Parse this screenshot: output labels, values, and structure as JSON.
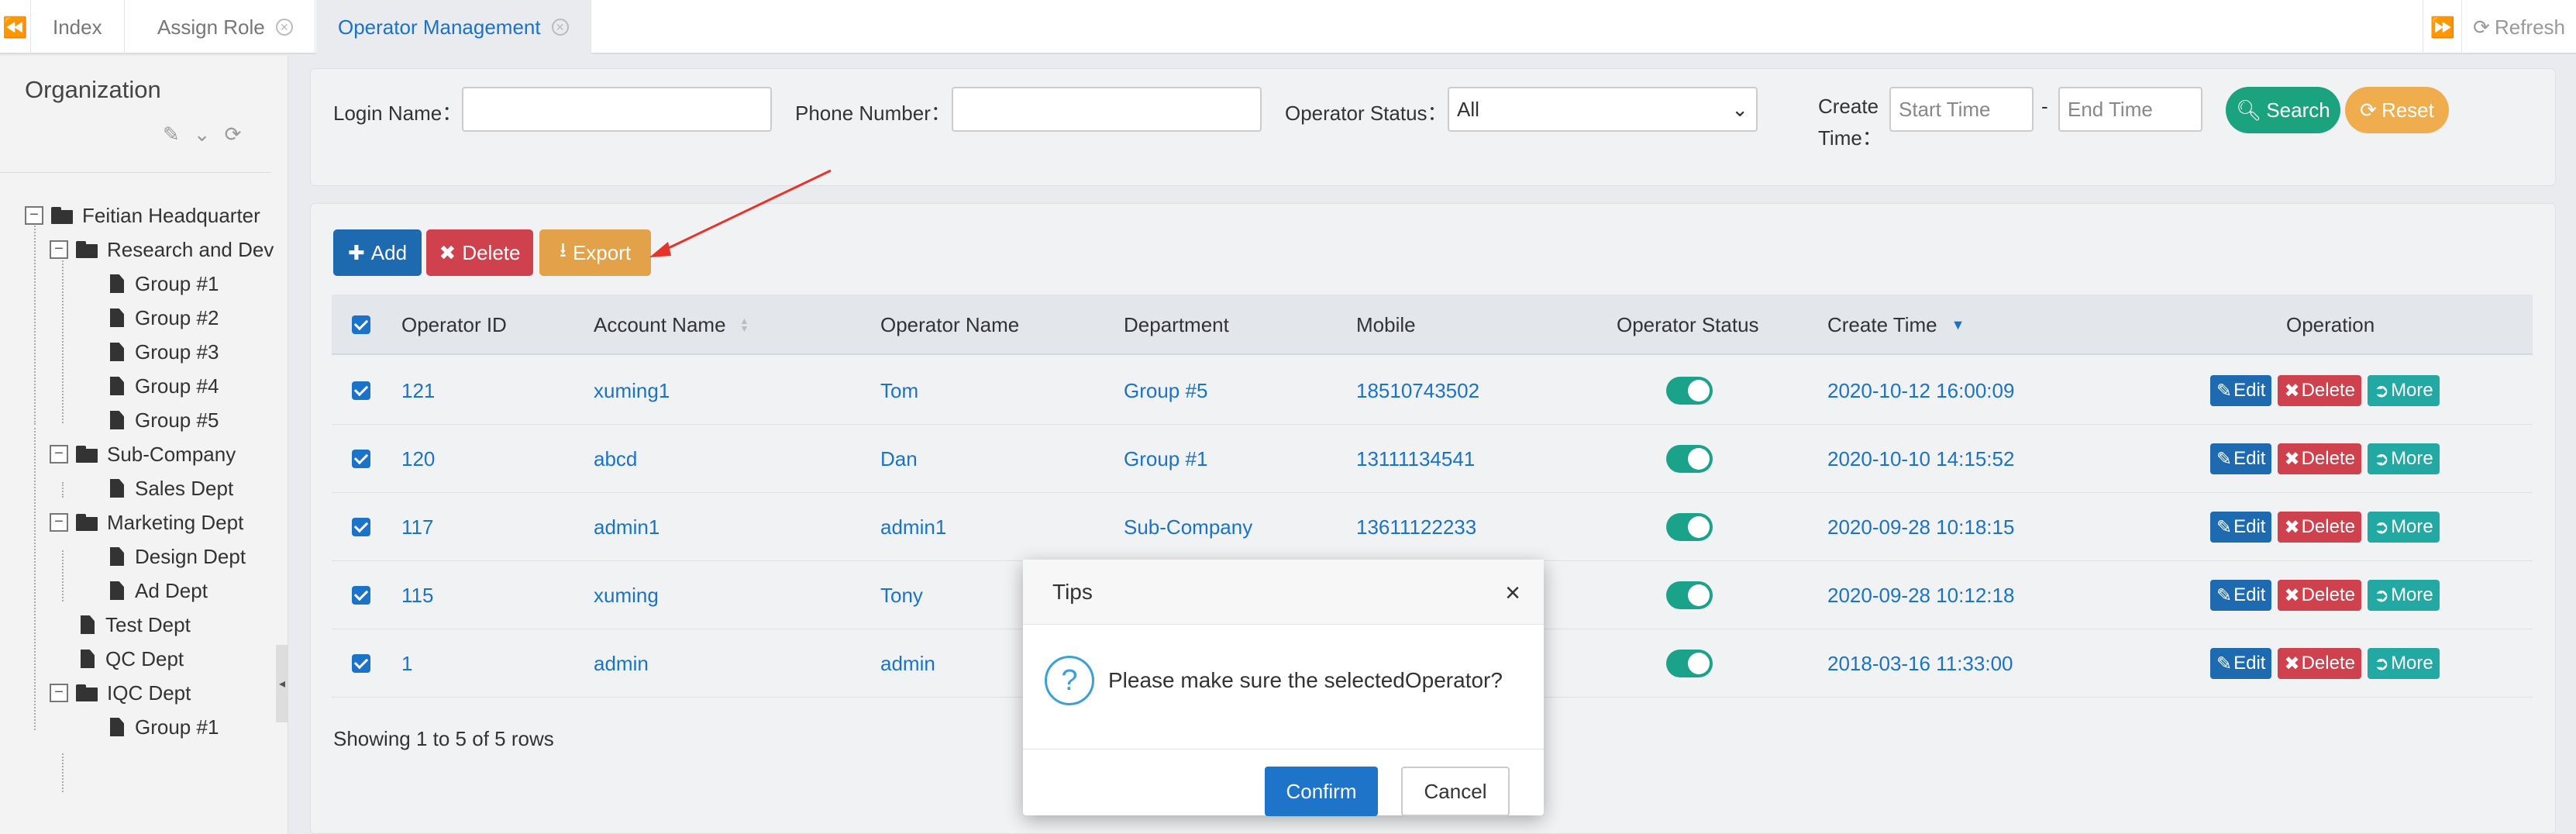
{
  "tabs": [
    {
      "label": "Index"
    },
    {
      "label": "Assign Role"
    },
    {
      "label": "Operator Management"
    }
  ],
  "topright": {
    "refresh_label": "Refresh"
  },
  "sidebar": {
    "title": "Organization",
    "tree": [
      {
        "label": "Feitian Headquarter"
      },
      {
        "label": "Research and Dev"
      },
      {
        "label": "Group #1"
      },
      {
        "label": "Group #2"
      },
      {
        "label": "Group #3"
      },
      {
        "label": "Group #4"
      },
      {
        "label": "Group #5"
      },
      {
        "label": "Sub-Company"
      },
      {
        "label": "Sales Dept"
      },
      {
        "label": "Marketing Dept"
      },
      {
        "label": "Design Dept"
      },
      {
        "label": "Ad Dept"
      },
      {
        "label": "Test Dept"
      },
      {
        "label": "QC Dept"
      },
      {
        "label": "IQC Dept"
      },
      {
        "label": "Group #1"
      }
    ]
  },
  "search": {
    "login_name_label": "Login Name：",
    "login_name_value": "",
    "phone_label": "Phone Number：",
    "phone_value": "",
    "status_label": "Operator Status：",
    "status_value": "All",
    "create_time_label_1": "Create",
    "create_time_label_2": "Time：",
    "start_placeholder": "Start Time",
    "range_sep": "-",
    "end_placeholder": "End Time",
    "search_button": "Search",
    "reset_button": "Reset"
  },
  "toolbar": {
    "add": "Add",
    "delete": "Delete",
    "export": "Export"
  },
  "table": {
    "columns": [
      "Operator ID",
      "Account Name",
      "Operator Name",
      "Department",
      "Mobile",
      "Operator Status",
      "Create Time",
      "Operation"
    ],
    "rows": [
      {
        "id": "121",
        "account": "xuming1",
        "name": "Tom",
        "dept": "Group #5",
        "mobile": "18510743502",
        "time": "2020-10-12 16:00:09"
      },
      {
        "id": "120",
        "account": "abcd",
        "name": "Dan",
        "dept": "Group #1",
        "mobile": "13111134541",
        "time": "2020-10-10 14:15:52"
      },
      {
        "id": "117",
        "account": "admin1",
        "name": "admin1",
        "dept": "Sub-Company",
        "mobile": "13611122233",
        "time": "2020-09-28 10:18:15"
      },
      {
        "id": "115",
        "account": "xuming",
        "name": "Tony",
        "dept": "",
        "mobile": "",
        "time": "2020-09-28 10:12:18"
      },
      {
        "id": "1",
        "account": "admin",
        "name": "admin",
        "dept": "",
        "mobile": "",
        "time": "2018-03-16 11:33:00"
      }
    ],
    "op_edit": "Edit",
    "op_delete": "Delete",
    "op_more": "More",
    "footer": "Showing 1 to 5 of 5 rows"
  },
  "dialog": {
    "title": "Tips",
    "close": "×",
    "message": "Please make sure the selectedOperator?",
    "confirm": "Confirm",
    "cancel": "Cancel"
  },
  "colors": {
    "primary": "#1e6ab0",
    "danger": "#d0414e",
    "warning": "#e3a24a",
    "success": "#1aa37e",
    "link": "#1a73c8",
    "annotation_arrow": "#e8332a"
  }
}
